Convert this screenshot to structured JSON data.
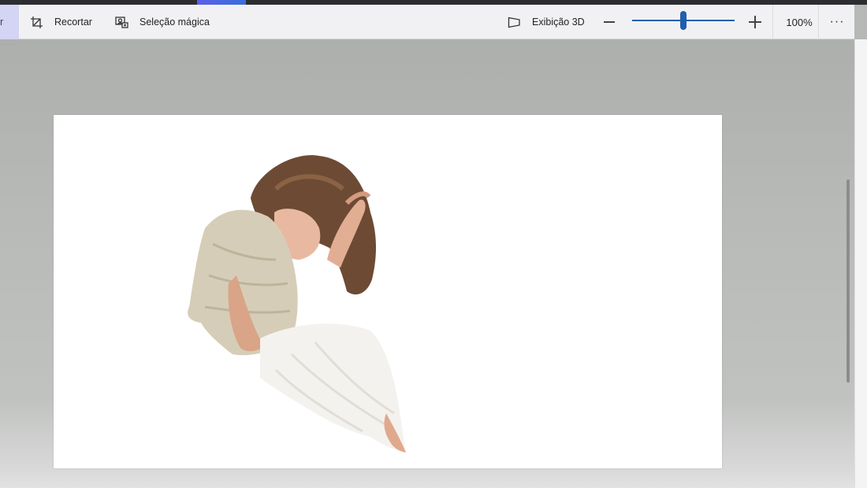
{
  "toolbar": {
    "partial_label": "r",
    "crop_label": "Recortar",
    "magic_select_label": "Seleção mágica",
    "view_3d_label": "Exibição 3D",
    "zoom_value": 0.5,
    "zoom_percent": "100%",
    "more_label": "···",
    "icons": {
      "crop": "crop-icon",
      "magic_select": "magic-select-icon",
      "view_3d": "view-3d-icon",
      "zoom_out": "minus-icon",
      "zoom_in": "plus-icon"
    }
  },
  "canvas": {
    "background": "#ffffff",
    "content": "cut-out photo of a seated woman in a white lace top and white skirt"
  },
  "colors": {
    "accent": "#1f5fae",
    "toolbar_bg": "#f1f1f3",
    "workspace_bg": "#b6b8b6"
  }
}
